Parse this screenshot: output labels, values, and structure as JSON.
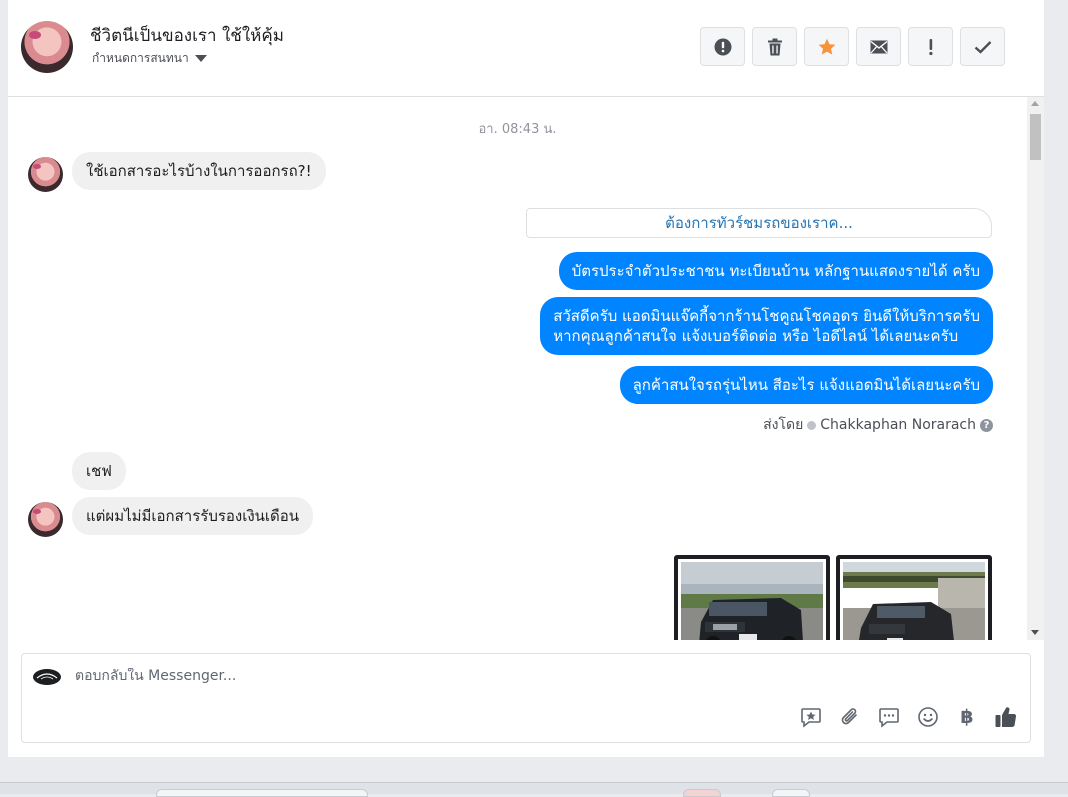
{
  "header": {
    "name": "ชีวิตนีเป็นของเรา ใช้ให้คุ้ม",
    "assign_label": "กำหนดการสนทนา",
    "toolbar": [
      {
        "name": "spam-button",
        "icon": "alert-circle-icon"
      },
      {
        "name": "delete-button",
        "icon": "trash-icon"
      },
      {
        "name": "star-button",
        "icon": "star-icon"
      },
      {
        "name": "mark-unread-button",
        "icon": "envelope-icon"
      },
      {
        "name": "follow-up-button",
        "icon": "exclamation-icon"
      },
      {
        "name": "mark-done-button",
        "icon": "checkmark-icon"
      }
    ],
    "star_color": "#f7923b"
  },
  "conversation": {
    "timestamp": "อา. 08:43 น.",
    "incoming_1": "ใช้เอกสารอะไรบ้างในการออกรถ?!",
    "quick_reply": "ต้องการทัวร์ชมรถของเราค...",
    "outgoing_1": "บัตรประจำตัวประชาชน ทะเบียนบ้าน หลักฐานแสดงรายได้ ครับ",
    "outgoing_2_line1": "สวัสดีครับ แอดมินแจ๊คกี้จากร้านโชคูณโชคอุดร ยินดีให้บริการครับ",
    "outgoing_2_line2": "หากคุณลูกค้าสนใจ แจ้งเบอร์ติดต่อ หรือ ไอดีไลน์ ได้เลยนะครับ",
    "outgoing_3": "ลูกค้าสนใจรถรุ่นไหน สีอะไร แจ้งแอดมินได้เลยนะครับ",
    "sent_by_label": "ส่งโดย",
    "sent_by_name": "Chakkaphan Norarach",
    "incoming_2": "เชฟ",
    "incoming_3": "แต่ผมไม่มีเอกสารรับรองเงินเดือน",
    "outgoing_color": "#0084ff",
    "incoming_color": "#f1f0f0"
  },
  "composer": {
    "placeholder": "ตอบกลับใน Messenger...",
    "icons": [
      "saved-reply-icon",
      "attachment-icon",
      "chat-bubble-icon",
      "emoji-icon",
      "baht-icon",
      "thumbs-up-icon"
    ],
    "baht_symbol": "฿"
  }
}
